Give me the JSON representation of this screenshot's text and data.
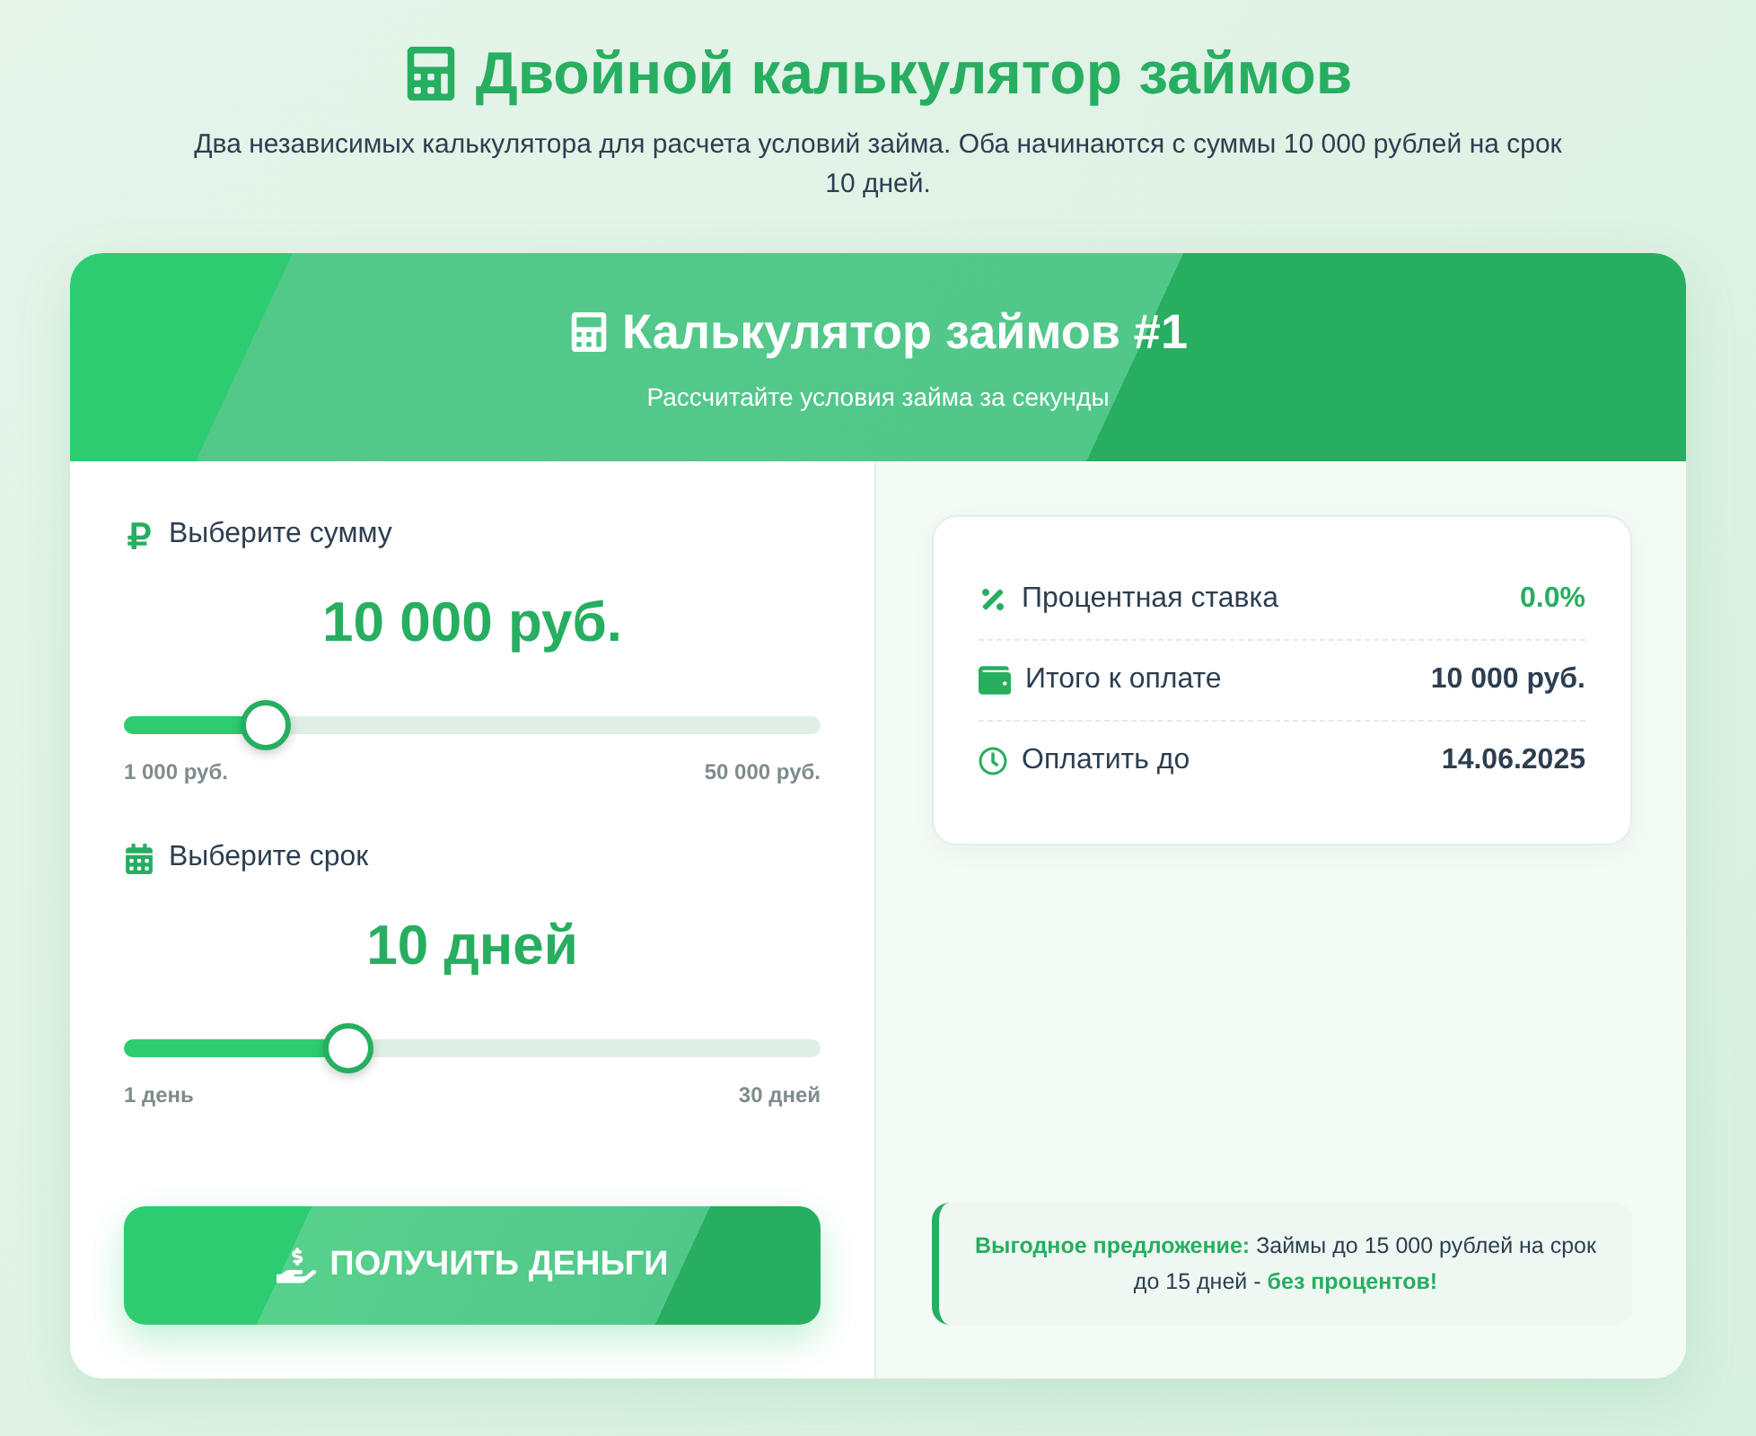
{
  "page": {
    "title": "Двойной калькулятор займов",
    "subtitle": "Два независимых калькулятора для расчета условий займа. Оба начинаются с суммы 10 000 рублей на срок 10 дней."
  },
  "calculator": {
    "title": "Калькулятор займов #1",
    "subtitle": "Рассчитайте условия займа за секунды",
    "sliders": [
      {
        "kind": "amount",
        "label": "Выберите сумму",
        "value": "10 000 руб.",
        "level": 0.2,
        "min": "1 000 руб.",
        "max": "50 000 руб."
      },
      {
        "kind": "term",
        "label": "Выберите срок",
        "value": "10 дней",
        "level": 0.32,
        "min": "1 день",
        "max": "30 дней"
      }
    ],
    "button": "ПОЛУЧИТЬ ДЕНЬГИ",
    "summary": [
      {
        "kind": "rate",
        "label": "Процентная ставка",
        "value": "0.0%",
        "highlight": true
      },
      {
        "kind": "total",
        "label": "Итого к оплате",
        "value": "10 000 руб.",
        "highlight": false
      },
      {
        "kind": "due",
        "label": "Оплатить до",
        "value": "14.06.2025",
        "highlight": false
      }
    ],
    "offer": "**Выгодное предложение:** Займы до 15 000 рублей на срок до 15 дней - **без процентов!**"
  }
}
